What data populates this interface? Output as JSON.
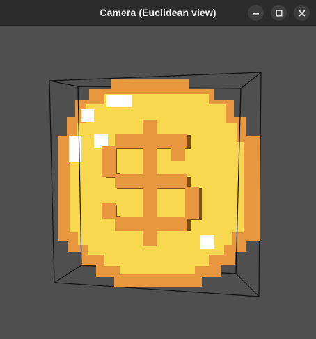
{
  "window": {
    "title": "Camera (Euclidean view)",
    "buttons": {
      "minimize": "minimize-icon",
      "maximize": "maximize-icon",
      "close": "close-icon"
    }
  },
  "scene": {
    "object": "gold coin with dollar sign (voxel)",
    "colors": {
      "background": "#4f4f4f",
      "coin_face": "#f7d84e",
      "coin_rim": "#e8973f",
      "coin_shadow": "#7a4e1e",
      "highlight": "#ffffff",
      "bounding_box": "#111111"
    }
  }
}
